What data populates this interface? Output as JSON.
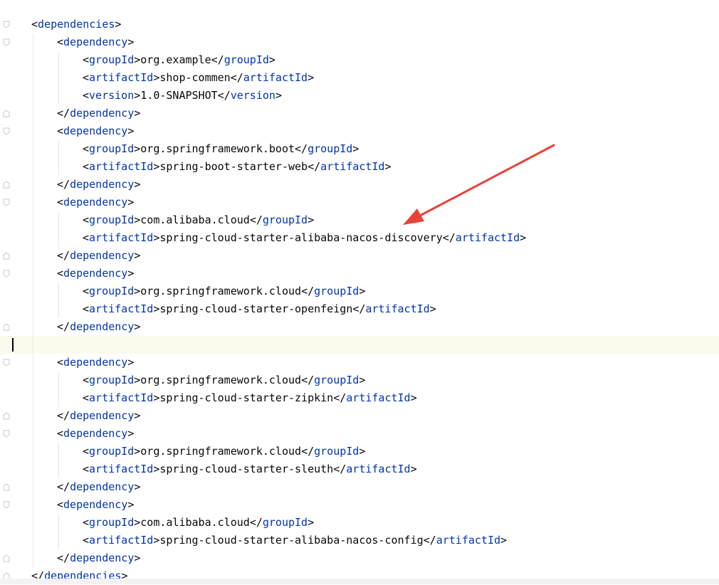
{
  "editor": {
    "lines": [
      {
        "indent": 0,
        "tag": "dependencies",
        "kind": "open"
      },
      {
        "indent": 1,
        "tag": "dependency",
        "kind": "open"
      },
      {
        "indent": 2,
        "tag": "groupId",
        "kind": "element",
        "value": "org.example"
      },
      {
        "indent": 2,
        "tag": "artifactId",
        "kind": "element",
        "value": "shop-commen"
      },
      {
        "indent": 2,
        "tag": "version",
        "kind": "element",
        "value": "1.0-SNAPSHOT"
      },
      {
        "indent": 1,
        "tag": "dependency",
        "kind": "close"
      },
      {
        "indent": 1,
        "tag": "dependency",
        "kind": "open"
      },
      {
        "indent": 2,
        "tag": "groupId",
        "kind": "element",
        "value": "org.springframework.boot"
      },
      {
        "indent": 2,
        "tag": "artifactId",
        "kind": "element",
        "value": "spring-boot-starter-web"
      },
      {
        "indent": 1,
        "tag": "dependency",
        "kind": "close"
      },
      {
        "indent": 1,
        "tag": "dependency",
        "kind": "open"
      },
      {
        "indent": 2,
        "tag": "groupId",
        "kind": "element",
        "value": "com.alibaba.cloud"
      },
      {
        "indent": 2,
        "tag": "artifactId",
        "kind": "element",
        "value": "spring-cloud-starter-alibaba-nacos-discovery"
      },
      {
        "indent": 1,
        "tag": "dependency",
        "kind": "close"
      },
      {
        "indent": 1,
        "tag": "dependency",
        "kind": "open"
      },
      {
        "indent": 2,
        "tag": "groupId",
        "kind": "element",
        "value": "org.springframework.cloud"
      },
      {
        "indent": 2,
        "tag": "artifactId",
        "kind": "element",
        "value": "spring-cloud-starter-openfeign"
      },
      {
        "indent": 1,
        "tag": "dependency",
        "kind": "close"
      },
      {
        "indent": 0,
        "tag": "",
        "kind": "blank",
        "current": true
      },
      {
        "indent": 1,
        "tag": "dependency",
        "kind": "open"
      },
      {
        "indent": 2,
        "tag": "groupId",
        "kind": "element",
        "value": "org.springframework.cloud"
      },
      {
        "indent": 2,
        "tag": "artifactId",
        "kind": "element",
        "value": "spring-cloud-starter-zipkin"
      },
      {
        "indent": 1,
        "tag": "dependency",
        "kind": "close"
      },
      {
        "indent": 1,
        "tag": "dependency",
        "kind": "open"
      },
      {
        "indent": 2,
        "tag": "groupId",
        "kind": "element",
        "value": "org.springframework.cloud"
      },
      {
        "indent": 2,
        "tag": "artifactId",
        "kind": "element",
        "value": "spring-cloud-starter-sleuth"
      },
      {
        "indent": 1,
        "tag": "dependency",
        "kind": "close"
      },
      {
        "indent": 1,
        "tag": "dependency",
        "kind": "open"
      },
      {
        "indent": 2,
        "tag": "groupId",
        "kind": "element",
        "value": "com.alibaba.cloud"
      },
      {
        "indent": 2,
        "tag": "artifactId",
        "kind": "element",
        "value": "spring-cloud-starter-alibaba-nacos-config"
      },
      {
        "indent": 1,
        "tag": "dependency",
        "kind": "close"
      },
      {
        "indent": 0,
        "tag": "dependencies",
        "kind": "close"
      }
    ],
    "colors": {
      "tag": "#0033b3",
      "text": "#080808",
      "current_line": "#fcfaed",
      "arrow": "#e8403a",
      "fold_marker": "#c8c8c8"
    },
    "annotation": {
      "icon": "red-arrow-icon",
      "points_to_line": 13
    }
  }
}
